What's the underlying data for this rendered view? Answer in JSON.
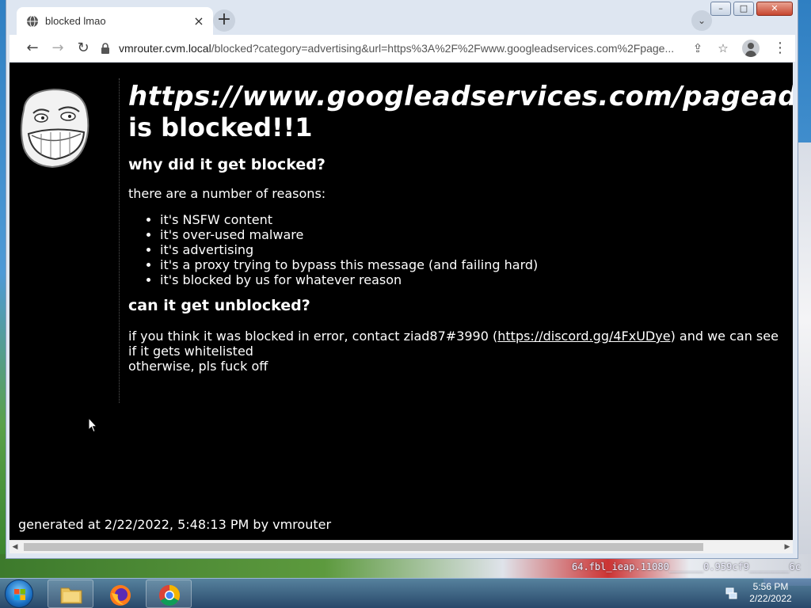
{
  "desktop": {
    "wallpaper_text": "64.fbl_ieap.11080______0.959cf9_______6c"
  },
  "browser": {
    "tab": {
      "title": "blocked lmao",
      "close_glyph": "×"
    },
    "new_tab_glyph": "+",
    "tab_search_glyph": "⌄",
    "window_controls": {
      "minimize": "–",
      "maximize": "□",
      "close": "✕"
    },
    "nav": {
      "back": "←",
      "forward": "→",
      "reload": "↻"
    },
    "address": {
      "host": "vmrouter.cvm.local",
      "path": "/blocked?category=advertising&url=https%3A%2F%2Fwww.googleadservices.com%2Fpage..."
    },
    "toolbar_icons": {
      "share": "⇪",
      "bookmark": "☆",
      "menu": "⋮"
    }
  },
  "page": {
    "blocked_url": "https://www.googleadservices.com/pagead/aclk",
    "blocked_suffix": "is blocked!!1",
    "why_heading": "why did it get blocked?",
    "reasons_intro": "there are a number of reasons:",
    "reasons": [
      "it's NSFW content",
      "it's over-used malware",
      "it's advertising",
      "it's a proxy trying to bypass this message (and failing hard)",
      "it's blocked by us for whatever reason"
    ],
    "unblock_heading": "can it get unblocked?",
    "contact_prefix": "if you think it was blocked in error, contact ziad87#3990 (",
    "contact_link": "https://discord.gg/4FxUDye",
    "contact_suffix": ") and we can see if it gets whitelisted",
    "otherwise": "otherwise, pls fuck off",
    "footer": "generated at 2/22/2022, 5:48:13 PM by vmrouter"
  },
  "taskbar": {
    "apps": [
      "file-explorer",
      "firefox",
      "chrome"
    ],
    "clock_time": "5:56 PM",
    "clock_date": "2/22/2022"
  }
}
